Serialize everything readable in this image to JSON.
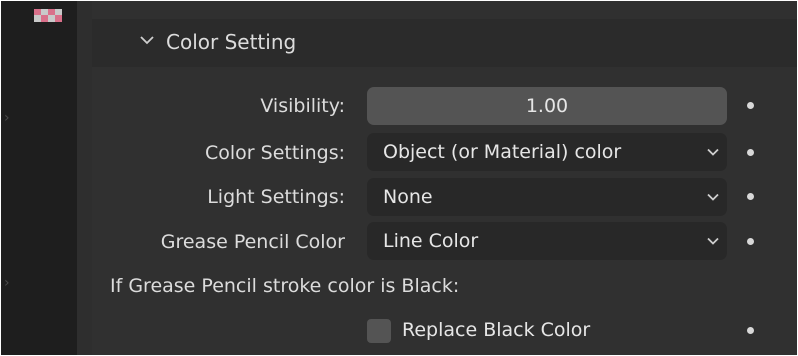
{
  "panel": {
    "title": "Color Setting",
    "rows": [
      {
        "label": "Visibility:",
        "value": "1.00",
        "kind": "number"
      },
      {
        "label": "Color Settings:",
        "value": "Object (or Material) color",
        "kind": "dropdown"
      },
      {
        "label": "Light Settings:",
        "value": "None",
        "kind": "dropdown"
      },
      {
        "label": "Grease Pencil Color",
        "value": "Line Color",
        "kind": "dropdown"
      }
    ],
    "note": "If Grease Pencil stroke color is Black:",
    "checkbox": {
      "label": "Replace Black Color",
      "checked": false
    }
  },
  "icons": {
    "header_toggle": "chevron-down-icon",
    "dropdown": "chevron-down-icon",
    "animate": "dot-icon",
    "material_preview": "checker-icon"
  },
  "colors": {
    "panel_bg": "#303030",
    "header_bg": "#2b2b2b",
    "field_number": "#545454",
    "field_dropdown": "#282828",
    "text": "#dcdcdc"
  }
}
